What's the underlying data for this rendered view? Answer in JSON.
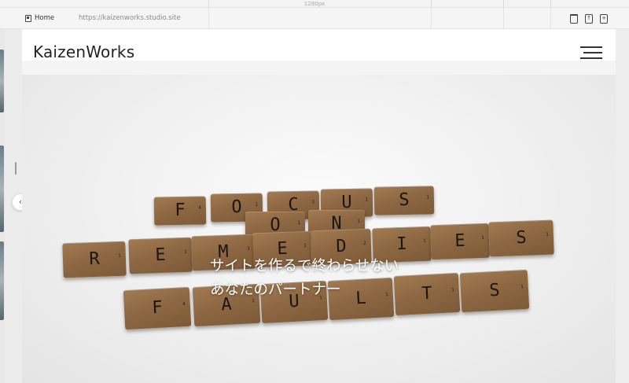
{
  "ruler": {
    "width_label": "1280px"
  },
  "toolbar": {
    "home_label": "Home",
    "url": "https://kaizenworks.studio.site"
  },
  "site": {
    "logo_text": "KaizenWorks",
    "hero_line1": "サイトを作るで終わらせない",
    "hero_line2": "あなたのパートナー"
  },
  "hero_image": {
    "tiles_row1": [
      "F",
      "O",
      "C",
      "U",
      "S"
    ],
    "tiles_row2": [
      "O",
      "N"
    ],
    "tiles_row3": [
      "R",
      "E",
      "M",
      "E",
      "D",
      "I",
      "E",
      "S"
    ],
    "tiles_row4": [
      "F",
      "A",
      "U",
      "L",
      "T",
      "S"
    ]
  },
  "icons": {
    "home": "page-icon",
    "trash": "trash-icon",
    "add_before": "add-page-before-icon",
    "add_after": "add-page-after-icon",
    "collapse": "chevron-left-icon",
    "menu": "hamburger-menu-icon"
  },
  "colors": {
    "tile_wood": "#8e6843",
    "hero_bg": "#efefef",
    "logo": "#222222"
  }
}
